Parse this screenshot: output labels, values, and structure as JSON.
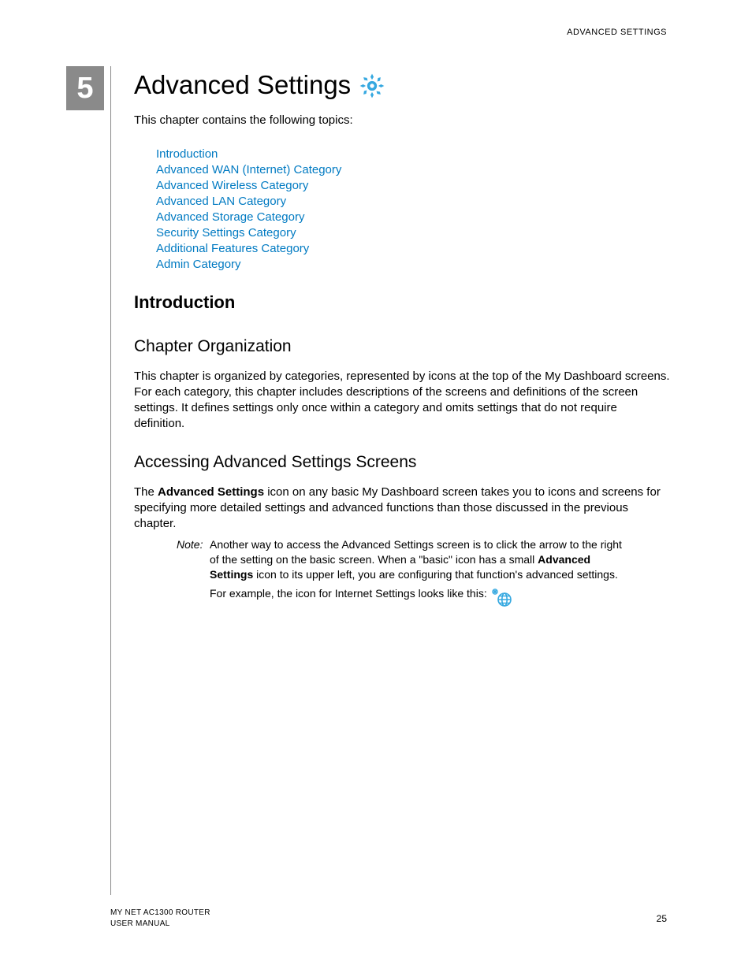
{
  "header": {
    "text": "ADVANCED SETTINGS"
  },
  "chapter": {
    "number": "5",
    "title": "Advanced Settings",
    "lead": "This chapter contains the following topics:"
  },
  "toc": [
    "Introduction",
    "Advanced WAN (Internet) Category",
    "Advanced Wireless Category",
    "Advanced LAN Category",
    "Advanced Storage Category",
    "Security Settings Category",
    "Additional Features Category",
    "Admin Category"
  ],
  "section": {
    "intro_heading": "Introduction",
    "org_heading": "Chapter Organization",
    "org_para": "This chapter is organized by categories, represented by icons at the top of the My Dashboard screens. For each category, this chapter includes descriptions of the screens and definitions of the screen settings. It defines settings only once within a category and omits settings that do not require definition.",
    "access_heading": "Accessing Advanced Settings Screens",
    "access_p1_a": "The ",
    "access_p1_bold": "Advanced Settings",
    "access_p1_b": " icon on any basic My Dashboard screen takes you to icons and screens for specifying more detailed settings and advanced functions than those discussed in the previous chapter.",
    "note_label": "Note:",
    "note_a": "Another way to access the Advanced Settings screen is to click the arrow to the right of the setting on the basic screen. When a \"basic\" icon has a small ",
    "note_bold": "Advanced Settings",
    "note_b": " icon to its upper left, you are configuring that function's advanced settings. For example, the icon for Internet Settings looks like this: "
  },
  "footer": {
    "line1": "MY NET AC1300 ROUTER",
    "line2": "USER MANUAL",
    "page": "25"
  },
  "colors": {
    "link": "#007ac2",
    "icon": "#35a8e0",
    "chapter_box": "#8a8a8a"
  }
}
